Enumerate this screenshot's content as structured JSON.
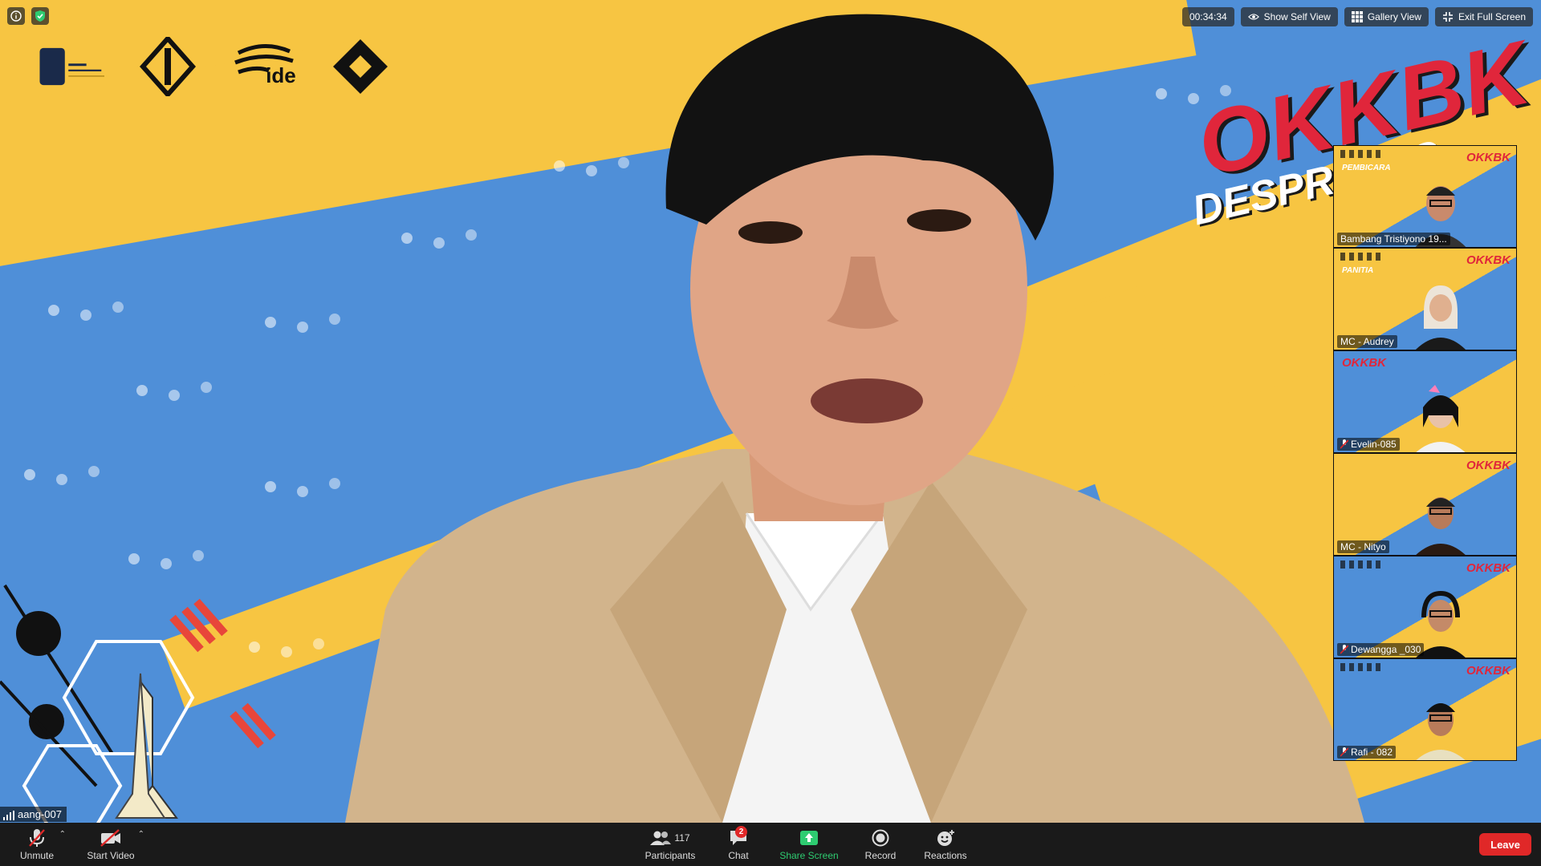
{
  "top_left": {
    "info_icon": "info-icon",
    "security_icon": "shield-check-icon"
  },
  "top_controls": {
    "timer": "00:34:34",
    "show_self_view": "Show Self View",
    "gallery_view": "Gallery View",
    "exit_full_screen": "Exit Full Screen"
  },
  "background": {
    "logo_text": "ide",
    "brand_title": "OKKBK",
    "brand_subtitle": "DESPRO ITS"
  },
  "gallery": {
    "tiles": [
      {
        "name": "Bambang Tristiyono 19...",
        "tag": "PEMBICARA",
        "muted": false
      },
      {
        "name": "MC - Audrey",
        "tag": "PANITIA",
        "muted": false
      },
      {
        "name": "Evelin-085",
        "tag": "",
        "muted": true
      },
      {
        "name": "MC - Nityo",
        "tag": "",
        "muted": false
      },
      {
        "name": "Dewangga _030",
        "tag": "",
        "muted": true
      },
      {
        "name": "Rafi - 082",
        "tag": "",
        "muted": true
      }
    ]
  },
  "self_label": {
    "name": "aang-007"
  },
  "toolbar": {
    "unmute": "Unmute",
    "start_video": "Start Video",
    "participants": "Participants",
    "participants_count": "117",
    "chat": "Chat",
    "chat_badge": "2",
    "share_screen": "Share Screen",
    "record": "Record",
    "reactions": "Reactions",
    "leave": "Leave"
  },
  "colors": {
    "yellow": "#f7c542",
    "blue": "#4f8fd8",
    "red": "#e0263b",
    "share_green": "#2ecc71",
    "leave_red": "#e02828",
    "toolbar_bg": "#1a1a1a"
  }
}
